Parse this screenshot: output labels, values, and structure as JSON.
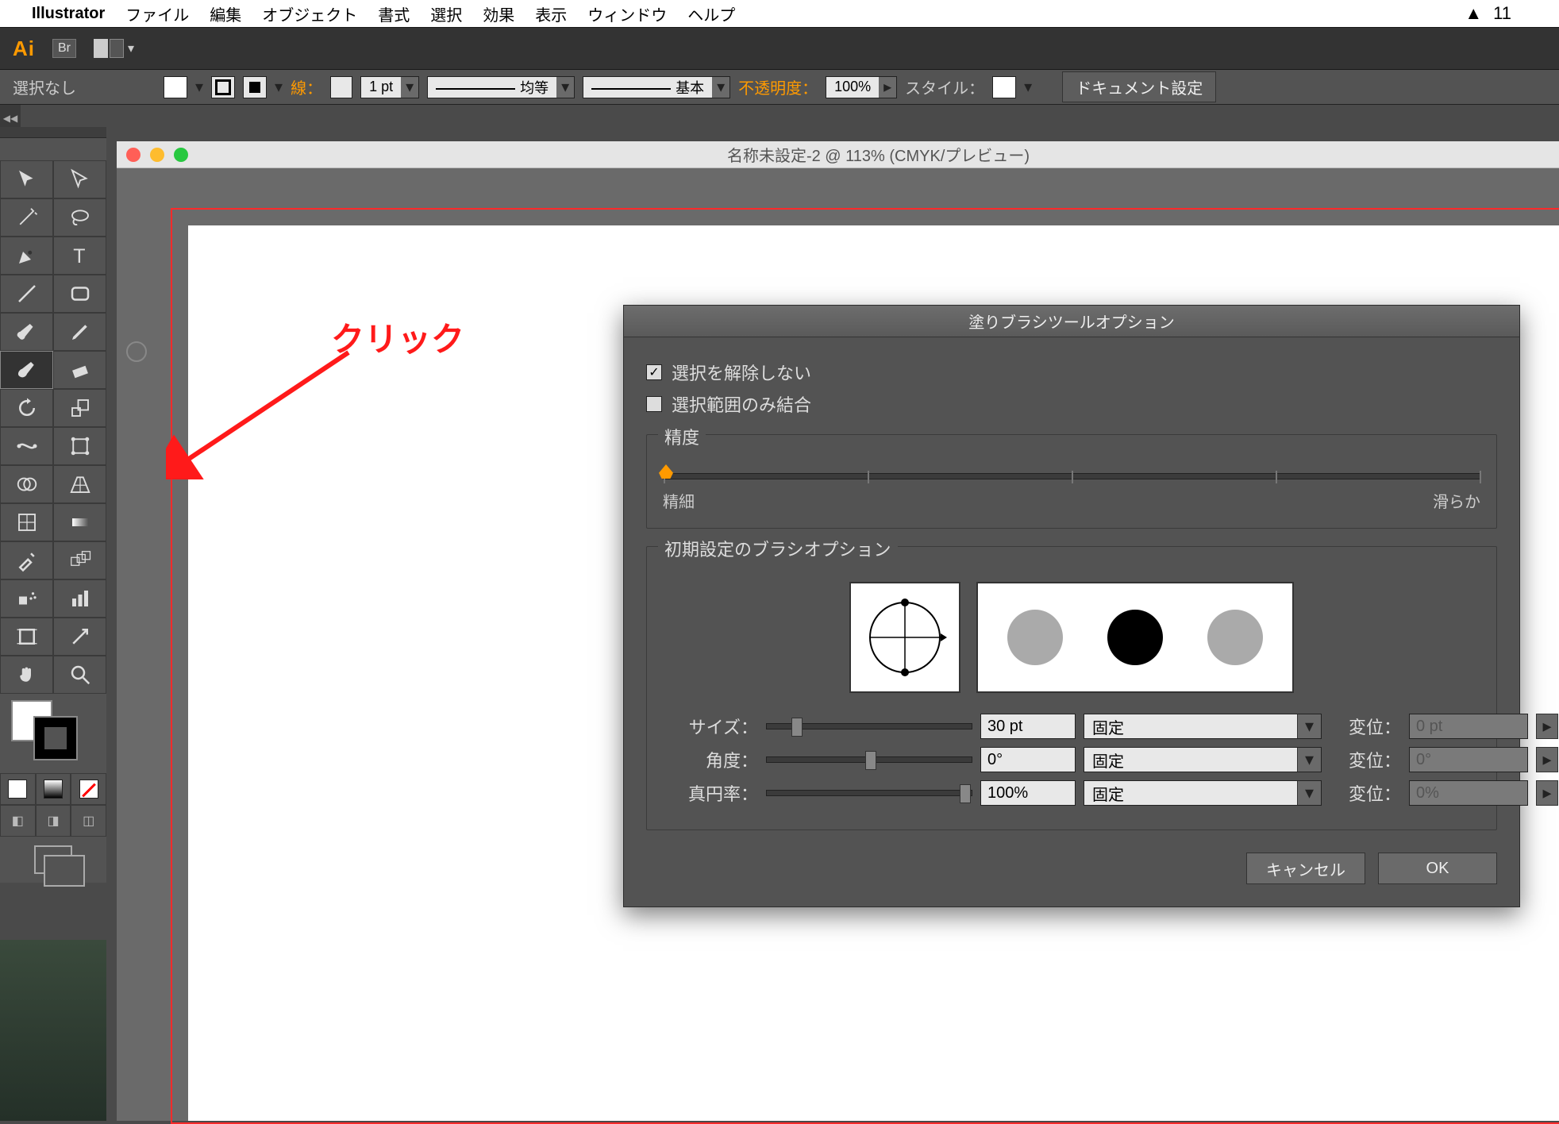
{
  "menubar": {
    "app": "Illustrator",
    "items": [
      "ファイル",
      "編集",
      "オブジェクト",
      "書式",
      "選択",
      "効果",
      "表示",
      "ウィンドウ",
      "ヘルプ"
    ],
    "right_num": "11"
  },
  "appchrome": {
    "ai": "Ai",
    "br": "Br"
  },
  "optbar": {
    "noselect": "選択なし",
    "stroke_label": "線：",
    "stroke_weight": "1 pt",
    "dash_label": "均等",
    "profile_label": "基本",
    "opacity_label": "不透明度：",
    "opacity_value": "100%",
    "style_label": "スタイル：",
    "docset_btn": "ドキュメント設定"
  },
  "docwin": {
    "title": "名称未設定-2 @ 113% (CMYK/プレビュー)"
  },
  "annotation": {
    "text": "クリック"
  },
  "dialog": {
    "title": "塗りブラシツールオプション",
    "chk_keep": "選択を解除しない",
    "chk_merge": "選択範囲のみ結合",
    "precision_legend": "精度",
    "precision_min": "精細",
    "precision_max": "滑らか",
    "brushopts_legend": "初期設定のブラシオプション",
    "rows": {
      "size": {
        "label": "サイズ：",
        "value": "30 pt",
        "mode": "固定",
        "var_label": "変位：",
        "var_value": "0 pt"
      },
      "angle": {
        "label": "角度：",
        "value": "0°",
        "mode": "固定",
        "var_label": "変位：",
        "var_value": "0°"
      },
      "round": {
        "label": "真円率：",
        "value": "100%",
        "mode": "固定",
        "var_label": "変位：",
        "var_value": "0%"
      }
    },
    "cancel": "キャンセル",
    "ok": "OK"
  }
}
